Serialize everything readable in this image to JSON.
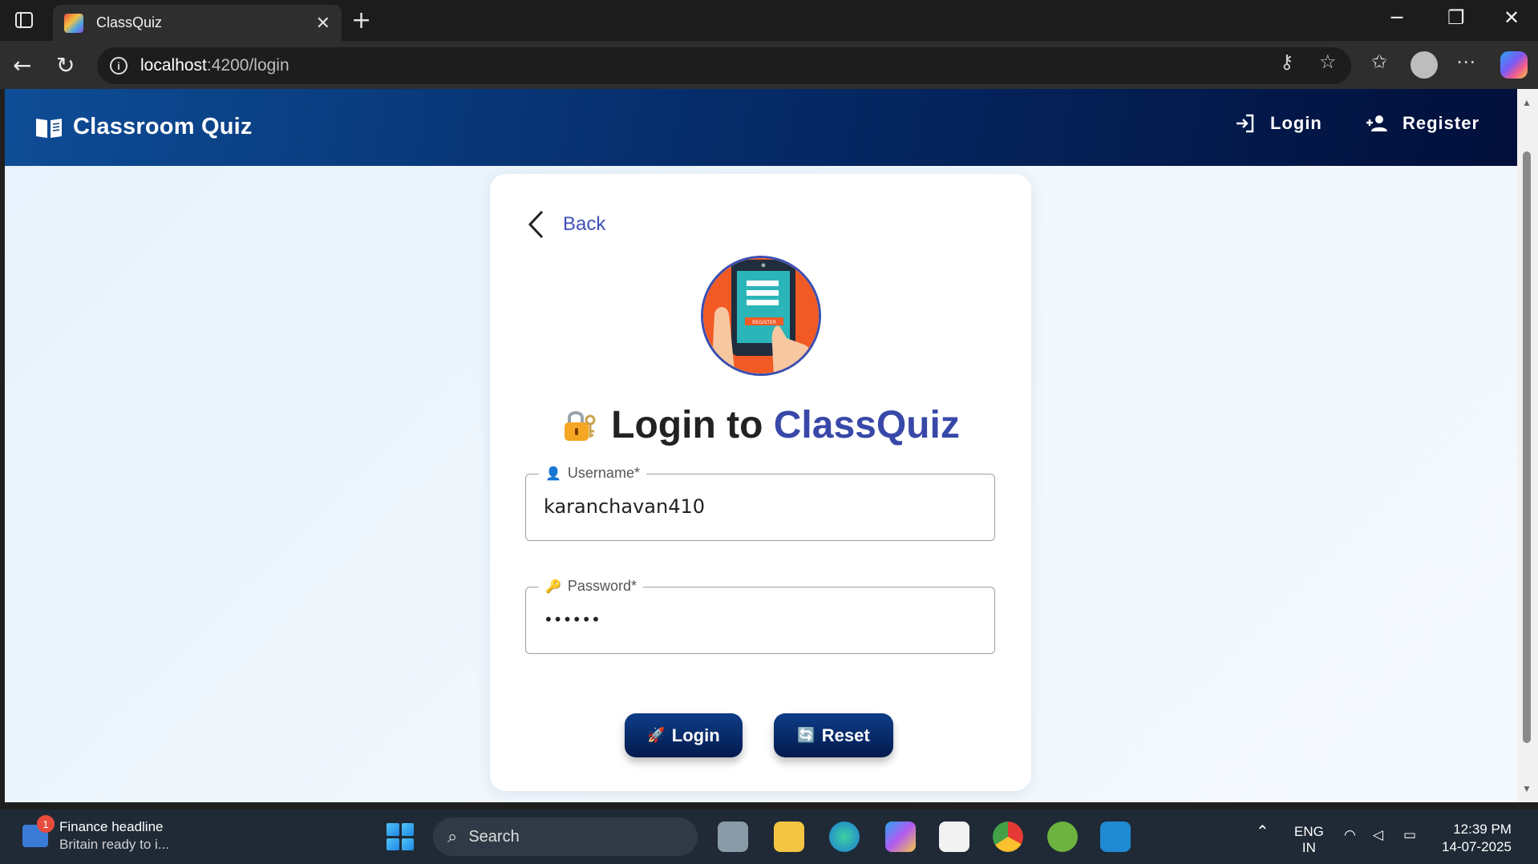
{
  "browser": {
    "tab_title": "ClassQuiz",
    "url_host": "localhost",
    "url_path": ":4200/login"
  },
  "app": {
    "brand": "Classroom Quiz",
    "nav": {
      "login": "Login",
      "register": "Register"
    }
  },
  "card": {
    "back_label": "Back",
    "heading_prefix": "Login to ",
    "heading_accent": "ClassQuiz",
    "logo_text": "REGISTER",
    "username": {
      "label": "Username*",
      "value": "karanchavan410",
      "icon": "👤"
    },
    "password": {
      "label": "Password*",
      "value": "••••••",
      "icon": "🔑"
    },
    "login_button": "Login",
    "login_emoji": "🚀",
    "reset_button": "Reset",
    "reset_emoji": "🔄"
  },
  "taskbar": {
    "news_badge": "1",
    "news_title": "Finance headline",
    "news_sub": "Britain ready to i...",
    "search": "Search",
    "lang1": "ENG",
    "lang2": "IN",
    "time": "12:39 PM",
    "date": "14-07-2025"
  }
}
